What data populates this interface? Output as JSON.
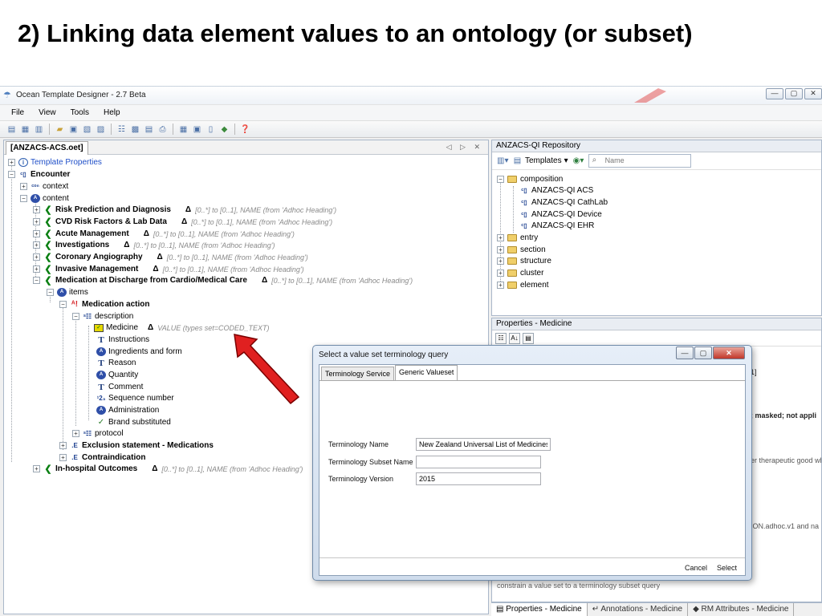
{
  "slide": {
    "title": "2) Linking data element values to an ontology (or subset)"
  },
  "window": {
    "title": "Ocean Template Designer - 2.7 Beta"
  },
  "menu": [
    "File",
    "View",
    "Tools",
    "Help"
  ],
  "editor": {
    "tab": "[ANZACS-ACS.oet]",
    "tree": {
      "template_properties": "Template Properties",
      "encounter": "Encounter",
      "context": "context",
      "content": "content",
      "sections": [
        {
          "label": "Risk Prediction and Diagnosis",
          "note": "[0..*] to [0..1], NAME (from 'Adhoc Heading')"
        },
        {
          "label": "CVD Risk Factors & Lab Data",
          "note": "[0..*] to [0..1], NAME (from 'Adhoc Heading')"
        },
        {
          "label": "Acute Management",
          "note": "[0..*] to [0..1], NAME (from 'Adhoc Heading')"
        },
        {
          "label": "Investigations",
          "note": "[0..*] to [0..1], NAME (from 'Adhoc Heading')"
        },
        {
          "label": "Coronary Angiography",
          "note": "[0..*] to [0..1], NAME (from 'Adhoc Heading')"
        },
        {
          "label": "Invasive Management",
          "note": "[0..*] to [0..1], NAME (from 'Adhoc Heading')"
        },
        {
          "label": "Medication at Discharge from Cardio/Medical Care",
          "note": "[0..*] to [0..1], NAME (from 'Adhoc Heading')"
        }
      ],
      "items": "items",
      "medication_action": "Medication action",
      "description": "description",
      "medicine": "Medicine",
      "medicine_note": "VALUE (types set=CODED_TEXT)",
      "delta": "Δ",
      "children": [
        "Instructions",
        "Ingredients and form",
        "Reason",
        "Quantity",
        "Comment",
        "Sequence number",
        "Administration",
        "Brand substituted"
      ],
      "protocol": "protocol",
      "exclusion": "Exclusion statement - Medications",
      "contraindication": "Contraindication",
      "inhospital": "In-hospital Outcomes",
      "inhospital_note": "[0..*] to [0..1], NAME (from 'Adhoc Heading')"
    }
  },
  "repository": {
    "title": "ANZACS-QI Repository",
    "templates_label": "Templates",
    "search_placeholder": "Name",
    "composition": "composition",
    "composition_items": [
      "ANZACS-QI ACS",
      "ANZACS-QI CathLab",
      "ANZACS-QI Device",
      "ANZACS-QI EHR"
    ],
    "folders": [
      "entry",
      "section",
      "structure",
      "cluster",
      "element"
    ]
  },
  "properties": {
    "title": "Properties - Medicine",
    "fragments": [
      "1]",
      "; masked; not appli",
      "er therapeutic good wh",
      "ION.adhoc.v1 and na",
      "constrain a value set to a terminology subset query"
    ],
    "bottom_tabs": [
      "Properties - Medicine",
      "Annotations - Medicine",
      "RM Attributes - Medicine"
    ]
  },
  "dialog": {
    "title": "Select a value set terminology query",
    "tabs": [
      "Terminology Service",
      "Generic Valueset"
    ],
    "fields": [
      {
        "label": "Terminology Name",
        "value": "New Zealand Universal List of Medicines"
      },
      {
        "label": "Terminology Subset Name",
        "value": ""
      },
      {
        "label": "Terminology Version",
        "value": "2015"
      }
    ],
    "cancel": "Cancel",
    "select": "Select"
  },
  "colors": {
    "arrow": "#e02020",
    "accent_blue": "#1f4fc8",
    "archetype_green": "#0a7f12"
  }
}
